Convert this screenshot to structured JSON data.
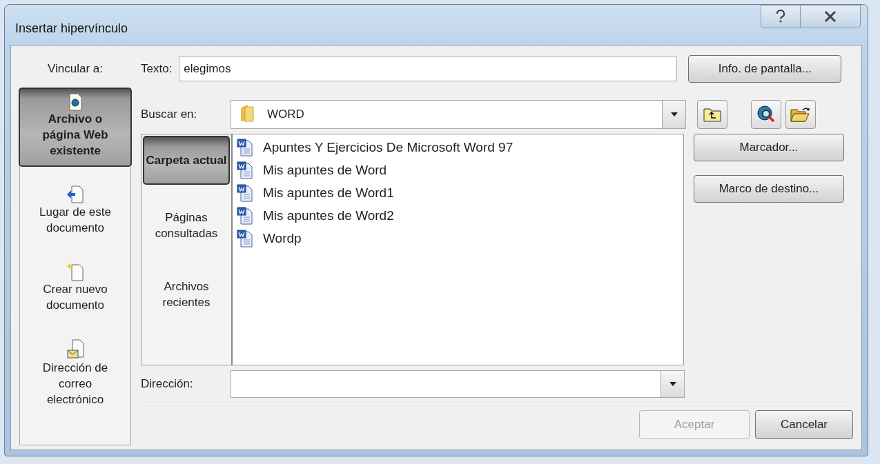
{
  "window": {
    "title": "Insertar hipervínculo"
  },
  "link_to": {
    "label": "Vincular a:",
    "items": [
      {
        "kind": "file",
        "label": "Archivo o página Web existente",
        "selected": true
      },
      {
        "kind": "place",
        "label": "Lugar de este documento",
        "selected": false
      },
      {
        "kind": "new",
        "label": "Crear nuevo documento",
        "selected": false
      },
      {
        "kind": "email",
        "label": "Dirección de correo electrónico",
        "selected": false
      }
    ]
  },
  "text_field": {
    "label": "Texto:",
    "value": "elegimos"
  },
  "screen_tip_button": "Info. de pantalla...",
  "look_in": {
    "label": "Buscar en:",
    "value": "WORD"
  },
  "nav": [
    {
      "label": "Carpeta actual",
      "selected": true
    },
    {
      "label": "Páginas consultadas",
      "selected": false
    },
    {
      "label": "Archivos recientes",
      "selected": false
    }
  ],
  "files": [
    "Apuntes Y Ejercicios De Microsoft Word 97",
    "Mis apuntes de Word",
    "Mis apuntes de Word1",
    "Mis apuntes de Word2",
    "Wordp"
  ],
  "side_buttons": [
    "Marcador...",
    "Marco de destino..."
  ],
  "address": {
    "label": "Dirección:"
  },
  "buttons": [
    {
      "label": "Aceptar",
      "disabled": true
    },
    {
      "label": "Cancelar",
      "disabled": false
    }
  ]
}
